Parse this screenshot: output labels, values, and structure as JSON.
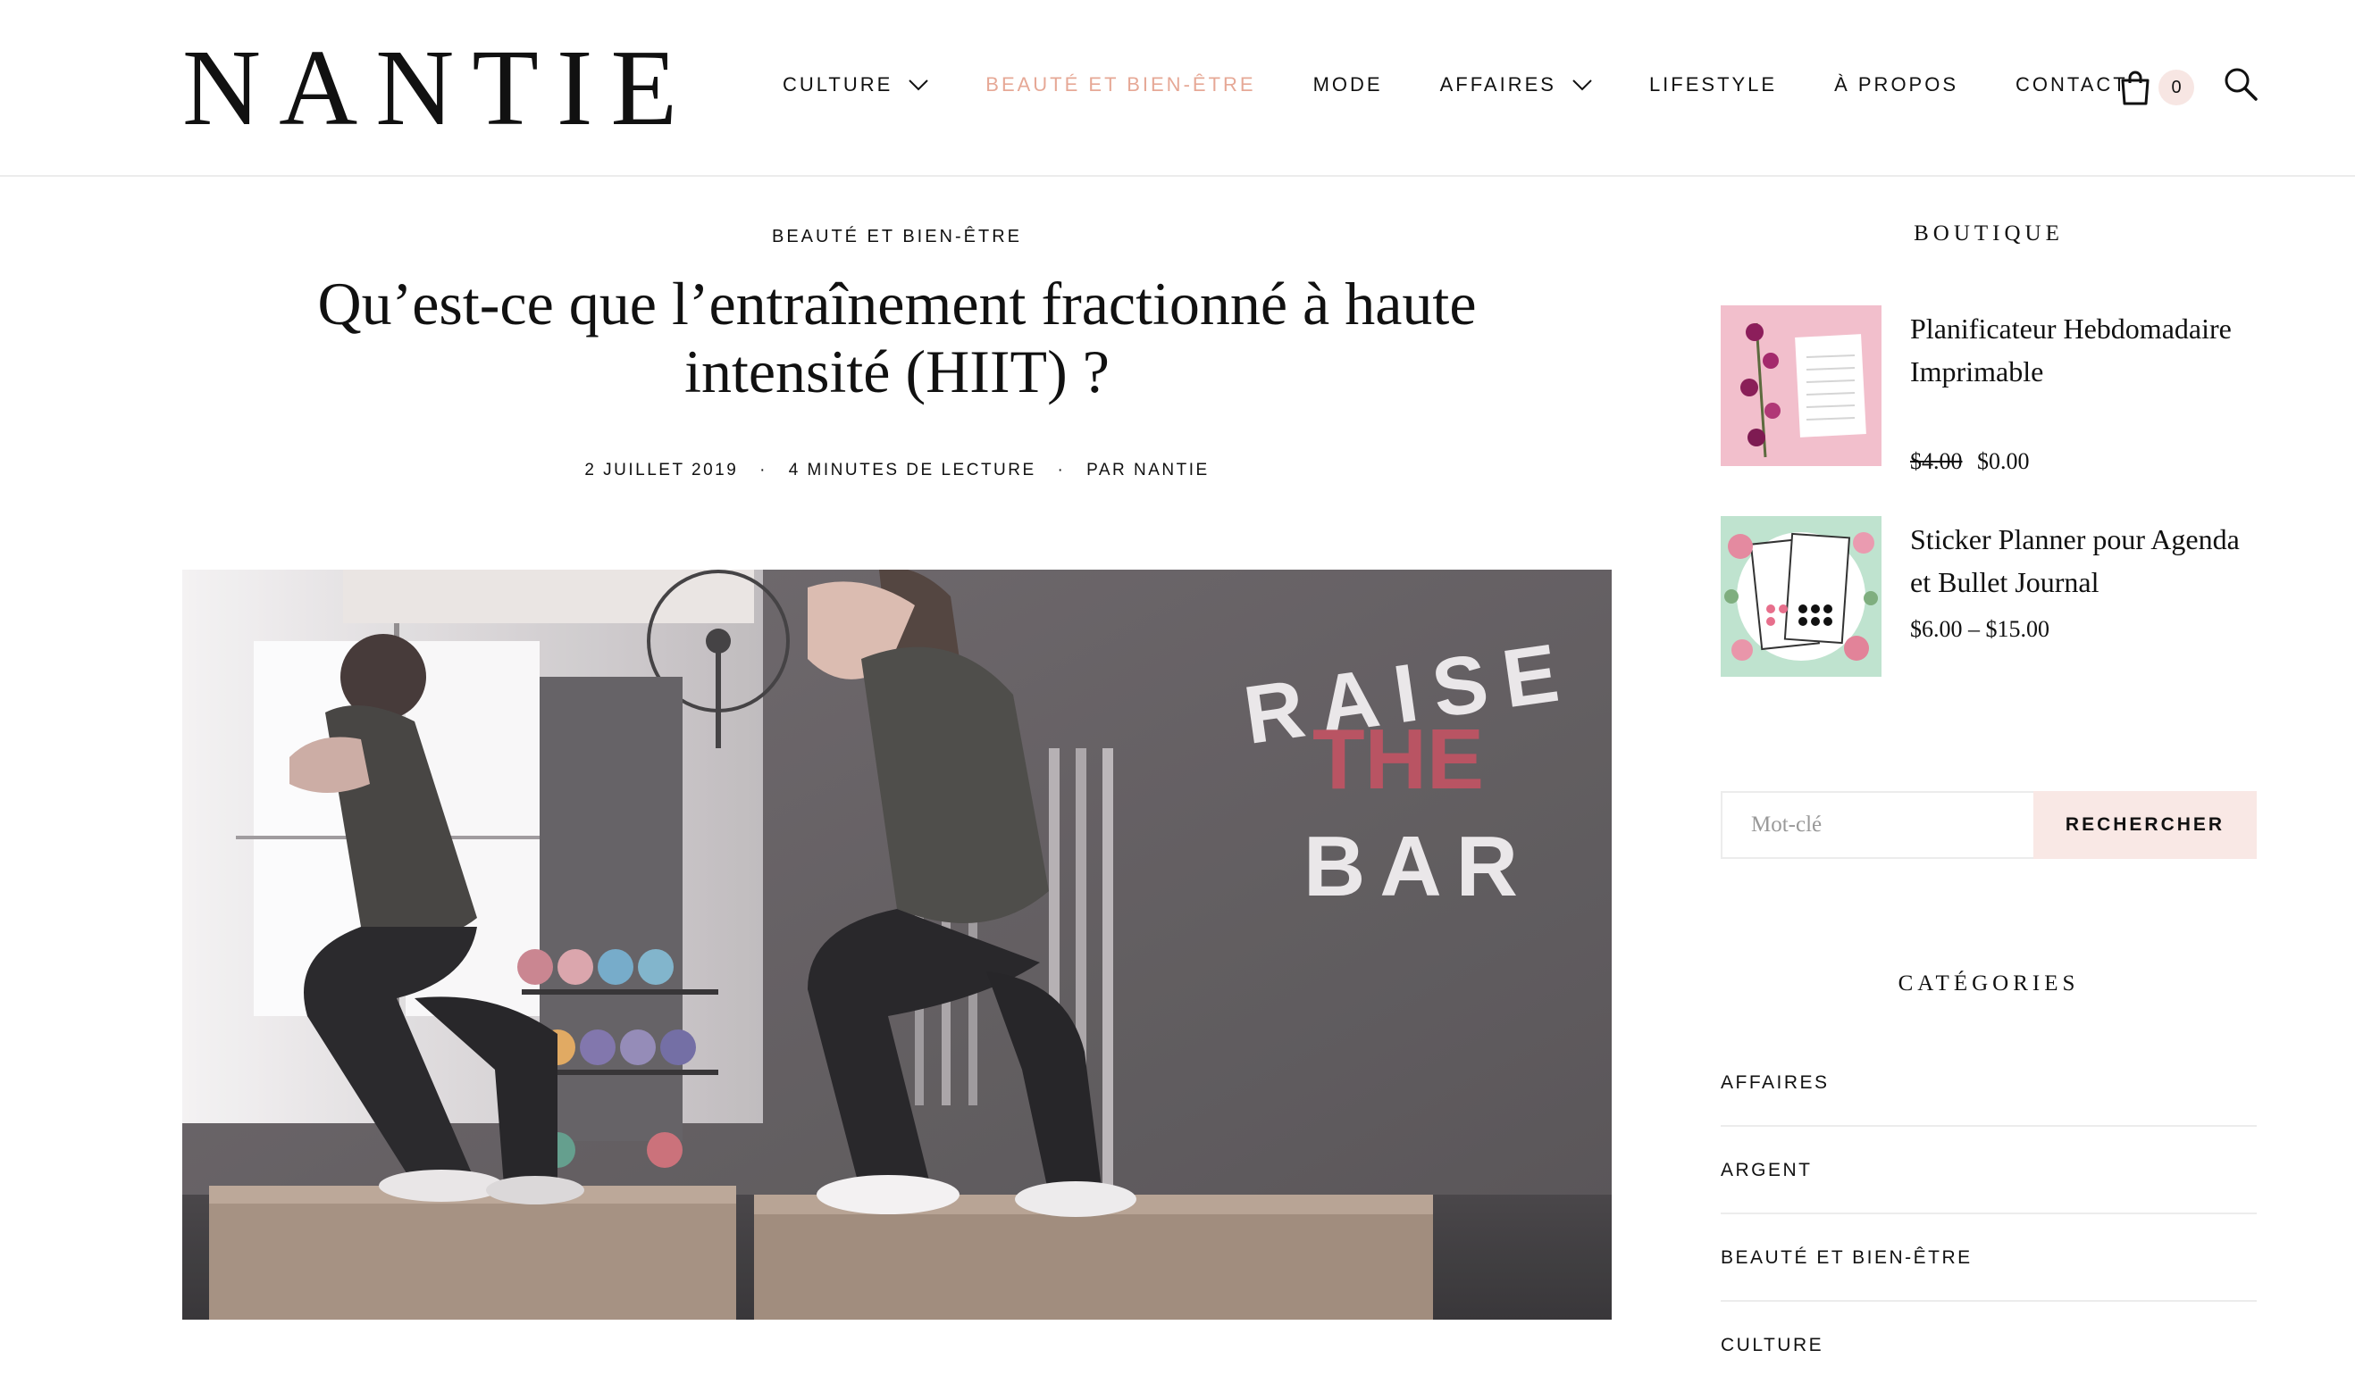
{
  "header": {
    "logo": "NANTIE",
    "nav": [
      {
        "label": "CULTURE",
        "dropdown": true,
        "active": false
      },
      {
        "label": "BEAUTÉ ET BIEN-ÊTRE",
        "dropdown": false,
        "active": true
      },
      {
        "label": "MODE",
        "dropdown": false,
        "active": false
      },
      {
        "label": "AFFAIRES",
        "dropdown": true,
        "active": false
      },
      {
        "label": "LIFESTYLE",
        "dropdown": false,
        "active": false
      },
      {
        "label": "À PROPOS",
        "dropdown": false,
        "active": false
      },
      {
        "label": "CONTACT",
        "dropdown": false,
        "active": false
      }
    ],
    "cart_icon": "shopping-bag-icon",
    "cart_count": "0",
    "search_icon": "search-icon",
    "accent_color": "#e6a896"
  },
  "article": {
    "category": "BEAUTÉ ET BIEN-ÊTRE",
    "title": "Qu’est-ce que l’entraînement fractionné à haute intensité (HIIT) ?",
    "date": "2 JUILLET 2019",
    "read_time": "4 MINUTES DE LECTURE",
    "author": "PAR NANTIE",
    "separator": "·",
    "hero_wall_text": [
      "RAISE",
      "THE",
      "BAR"
    ]
  },
  "sidebar": {
    "shop_title": "BOUTIQUE",
    "products": [
      {
        "name": "Planificateur Hebdomadaire Imprimable",
        "old_price": "$4.00",
        "price": "$0.00"
      },
      {
        "name": "Sticker Planner pour Agenda et Bullet Journal",
        "old_price": "",
        "price": "$6.00 – $15.00"
      }
    ],
    "search_placeholder": "Mot-clé",
    "search_button": "RECHERCHER",
    "categories_title": "CATÉGORIES",
    "categories": [
      "AFFAIRES",
      "ARGENT",
      "BEAUTÉ ET BIEN-ÊTRE",
      "CULTURE"
    ]
  }
}
